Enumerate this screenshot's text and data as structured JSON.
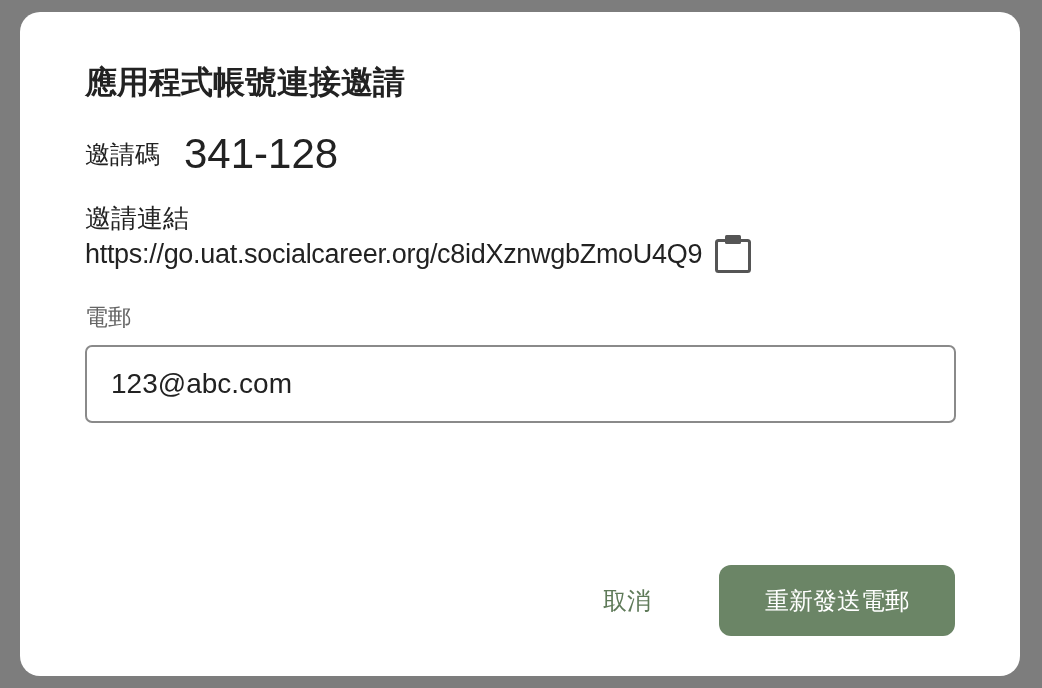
{
  "dialog": {
    "title": "應用程式帳號連接邀請",
    "invite_code": {
      "label": "邀請碼",
      "value": "341-128"
    },
    "invite_link": {
      "label": "邀請連結",
      "url": "https://go.uat.socialcareer.org/c8idXznwgbZmoU4Q9"
    },
    "email": {
      "label": "電郵",
      "value": "123@abc.com"
    },
    "buttons": [
      {
        "label": "取消",
        "kind": "text"
      },
      {
        "label": "重新發送電郵",
        "kind": "primary"
      }
    ]
  }
}
